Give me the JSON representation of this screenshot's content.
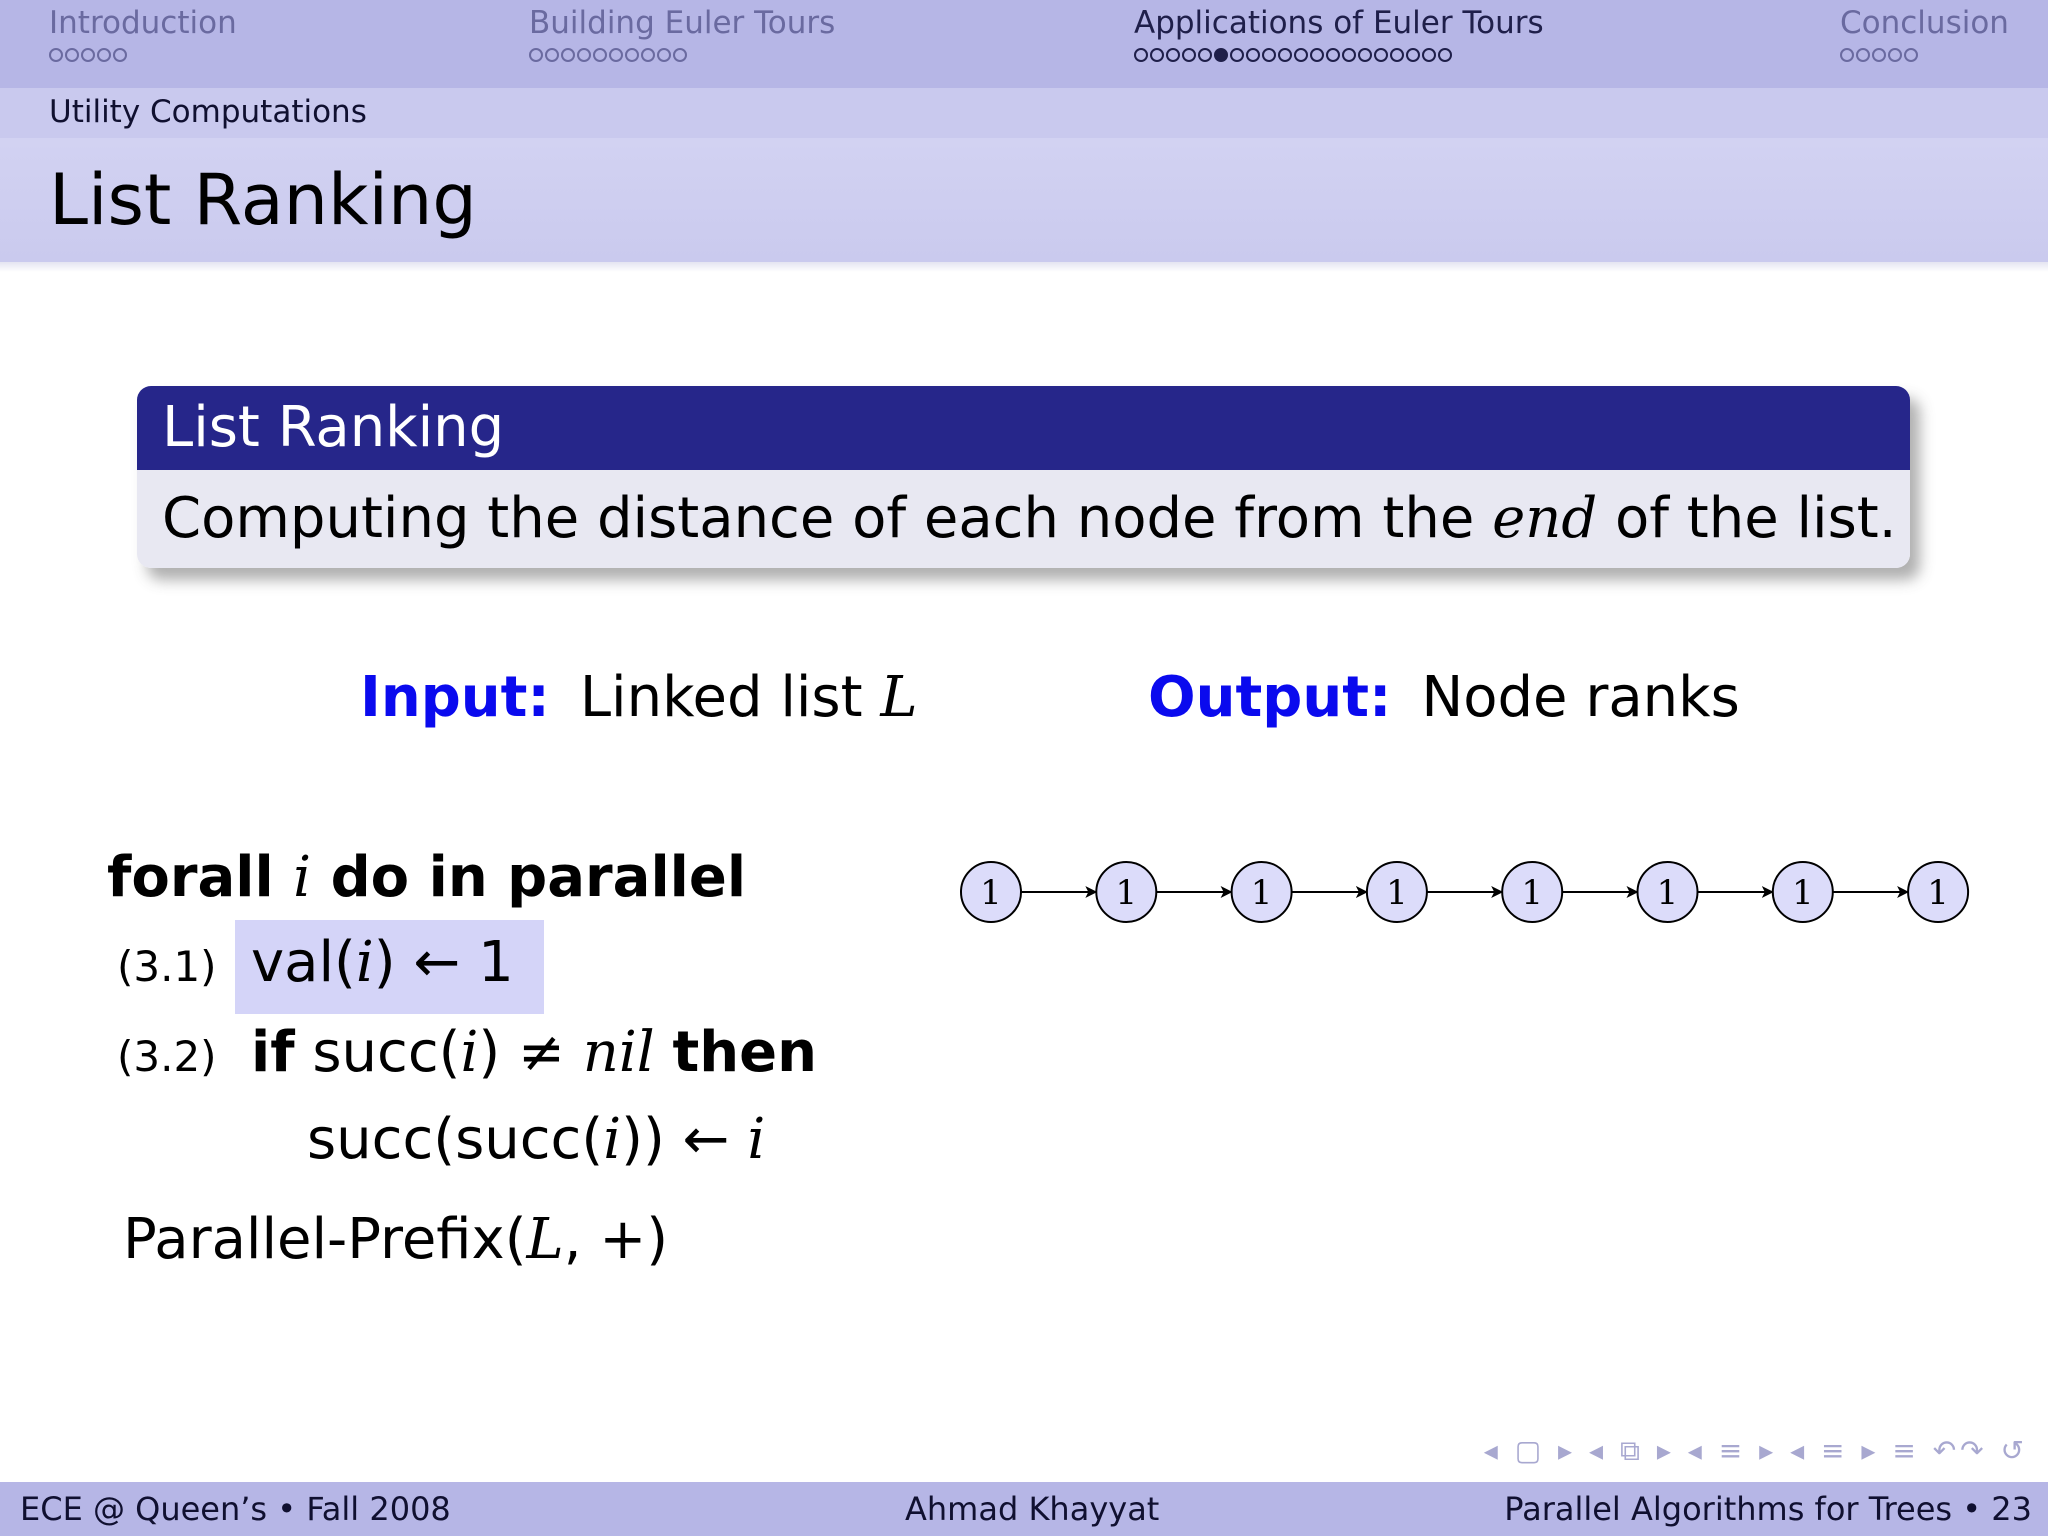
{
  "nav": {
    "sections": [
      {
        "title": "Introduction",
        "dots": 5,
        "active_dot": -1
      },
      {
        "title": "Building Euler Tours",
        "dots": 10,
        "active_dot": -1
      },
      {
        "title": "Applications of Euler Tours",
        "dots": 20,
        "active_dot": 5
      },
      {
        "title": "Conclusion",
        "dots": 5,
        "active_dot": -1
      }
    ]
  },
  "subsection": "Utility Computations",
  "frame_title": "List Ranking",
  "block": {
    "title": "List Ranking",
    "body_before": "Computing the distance of each node from the",
    "body_emph": "end",
    "body_after": "of the list."
  },
  "io": {
    "input_label": "Input:",
    "input_text": "Linked list",
    "input_var": "L",
    "output_label": "Output:",
    "output_text": "Node ranks"
  },
  "algorithm": {
    "forall_kw1": "forall",
    "forall_var": "i",
    "forall_kw2": "do in parallel",
    "step1_num": "(3.1)",
    "step1_fn": "val(",
    "step1_var": "i",
    "step1_rest": ") ← 1",
    "step2_num": "(3.2)",
    "step2_if": "if",
    "step2_fn": "succ(",
    "step2_var": "i",
    "step2_neq": ") ≠",
    "step2_nil": "nil",
    "step2_then": "then",
    "step3_fn": "succ(succ(",
    "step3_var": "i",
    "step3_arrow": ")) ←",
    "step3_var2": "i",
    "prefix_fn": "Parallel-Prefix(",
    "prefix_var": "L",
    "prefix_rest": ", +)"
  },
  "list_nodes": [
    "1",
    "1",
    "1",
    "1",
    "1",
    "1",
    "1",
    "1"
  ],
  "nav_symbols": "◂ ▢ ▸ ◂ ⧉ ▸ ◂ ≡ ▸ ◂ ≡ ▸ ≡ ↶↷ ↺",
  "footer": {
    "left": "ECE @ Queen’s • Fall 2008",
    "center": "Ahmad Khayyat",
    "right": "Parallel Algorithms for Trees • 23"
  },
  "colors": {
    "nav_bg": "#b6b6e6",
    "block_head": "#26268a",
    "block_body": "#e8e8f2",
    "alert_blue": "#0a0aee",
    "node_fill": "#dcdcfa"
  }
}
